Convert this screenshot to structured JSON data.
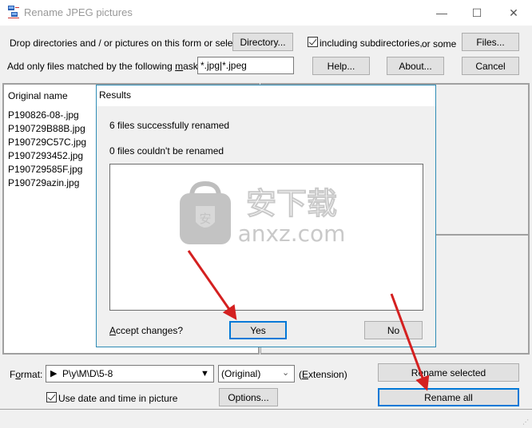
{
  "window": {
    "title": "Rename JPEG pictures",
    "minimize_glyph": "—",
    "maximize_glyph": "☐",
    "close_glyph": "✕"
  },
  "top": {
    "drop_text": "Drop directories and / or pictures on this form or select a",
    "directory_button": "Directory...",
    "subdirs_checked": true,
    "subdirs_label": "including subdirectories,",
    "or_some": "or some",
    "files_button": "Files...",
    "mask_label_pre": "Add only files matched by the following ",
    "mask_label_ul": "m",
    "mask_label_post": "ask(s) :",
    "mask_value": "*.jpg|*.jpeg",
    "help_button": "Help...",
    "about_button": "About...",
    "cancel_button": "Cancel"
  },
  "file_list": {
    "header": "Original name",
    "items": [
      "P190826-08-.jpg",
      "P190729B88B.jpg",
      "P190729C57C.jpg",
      "P1907293452.jpg",
      "P190729585F.jpg",
      "P190729azin.jpg"
    ]
  },
  "results_dialog": {
    "title": "Results",
    "success_text": "6 files successfully renamed",
    "failed_text": "0 files couldn't be renamed",
    "accept_ul": "A",
    "accept_rest": "ccept changes?",
    "yes_button": "Yes",
    "no_button": "No"
  },
  "watermark": {
    "cn_text": "安下载",
    "url_text": "anxz.com",
    "badge_char": "安"
  },
  "bottom": {
    "format_pre": "F",
    "format_ul": "o",
    "format_post": "rmat:",
    "format_value": "P\\y\\M\\D\\5-8",
    "extension_value": "(Original)",
    "extension_label_pre": "(",
    "extension_label_ul": "E",
    "extension_label_post": "xtension)",
    "use_date_checked": true,
    "use_date_label": "Use date and time in picture",
    "options_button": "Options...",
    "rename_selected_button": "Rename selected",
    "rename_all_button": "Rename all"
  },
  "colors": {
    "accent_focus": "#0078d7",
    "dialog_border": "#2e8bb5",
    "annotation_arrow": "#d42020"
  }
}
